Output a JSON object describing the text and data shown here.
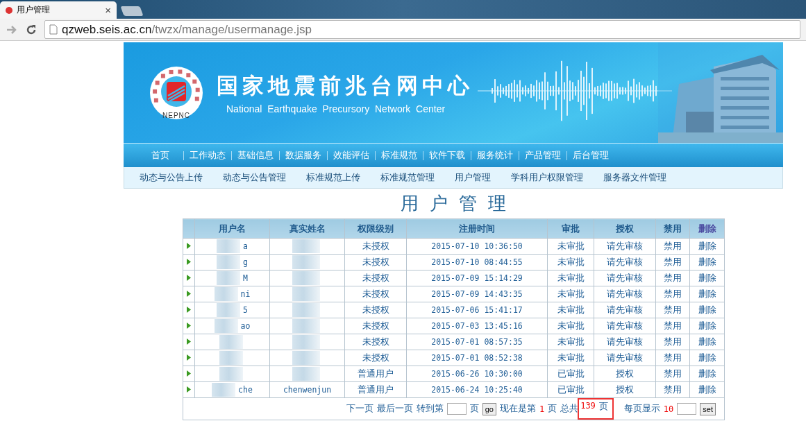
{
  "browser": {
    "tab": {
      "title": "用户管理",
      "close": "×"
    },
    "address": {
      "host": "qzweb.seis.ac.cn",
      "path": "/twzx/manage/usermanage.jsp"
    }
  },
  "banner": {
    "title": "国家地震前兆台网中心",
    "subtitle": "National  Earthquake  Precursory  Network  Center",
    "logo": {
      "letters": "NEPNC"
    }
  },
  "nav": {
    "items": [
      {
        "label": "首页"
      },
      {
        "label": "工作动态"
      },
      {
        "label": "基础信息"
      },
      {
        "label": "数据服务"
      },
      {
        "label": "效能评估"
      },
      {
        "label": "标准规范"
      },
      {
        "label": "软件下载"
      },
      {
        "label": "服务统计"
      },
      {
        "label": "产品管理"
      },
      {
        "label": "后台管理"
      }
    ]
  },
  "subnav": {
    "items": [
      {
        "label": "动态与公告上传"
      },
      {
        "label": "动态与公告管理"
      },
      {
        "label": "标准规范上传"
      },
      {
        "label": "标准规范管理"
      },
      {
        "label": "用户管理"
      },
      {
        "label": "学科用户权限管理"
      },
      {
        "label": "服务器文件管理"
      }
    ]
  },
  "page_title": "用 户 管 理",
  "table": {
    "redacted": true,
    "columns": [
      "用户名",
      "真实姓名",
      "权限级别",
      "注册时间",
      "审批",
      "授权",
      "禁用",
      "删除"
    ],
    "rows": [
      {
        "username": "a",
        "level": "未授权",
        "registered": "2015-07-10 10:36:50",
        "approval": "未审批",
        "authorize": "请先审核",
        "disable": "禁用",
        "delete": "删除"
      },
      {
        "username": "g",
        "level": "未授权",
        "registered": "2015-07-10 08:44:55",
        "approval": "未审批",
        "authorize": "请先审核",
        "disable": "禁用",
        "delete": "删除"
      },
      {
        "username": "M",
        "level": "未授权",
        "registered": "2015-07-09 15:14:29",
        "approval": "未审批",
        "authorize": "请先审核",
        "disable": "禁用",
        "delete": "删除"
      },
      {
        "username": "ni",
        "level": "未授权",
        "registered": "2015-07-09 14:43:35",
        "approval": "未审批",
        "authorize": "请先审核",
        "disable": "禁用",
        "delete": "删除"
      },
      {
        "username": "5",
        "level": "未授权",
        "registered": "2015-07-06 15:41:17",
        "approval": "未审批",
        "authorize": "请先审核",
        "disable": "禁用",
        "delete": "删除"
      },
      {
        "username": "ao",
        "level": "未授权",
        "registered": "2015-07-03 13:45:16",
        "approval": "未审批",
        "authorize": "请先审核",
        "disable": "禁用",
        "delete": "删除"
      },
      {
        "level": "未授权",
        "registered": "2015-07-01 08:57:35",
        "approval": "未审批",
        "authorize": "请先审核",
        "disable": "禁用",
        "delete": "删除"
      },
      {
        "level": "未授权",
        "registered": "2015-07-01 08:52:38",
        "approval": "未审批",
        "authorize": "请先审核",
        "disable": "禁用",
        "delete": "删除"
      },
      {
        "level": "普通用户",
        "registered": "2015-06-26 10:30:00",
        "approval": "已审批",
        "authorize": "授权",
        "disable": "禁用",
        "delete": "删除"
      },
      {
        "username": "che",
        "real_name": "chenwenjun",
        "level": "普通用户",
        "registered": "2015-06-24 10:25:40",
        "approval": "已审批",
        "authorize": "授权",
        "disable": "禁用",
        "delete": "删除"
      }
    ]
  },
  "pagination": {
    "next": "下一页",
    "last": "最后一页",
    "goto_label": "转到第",
    "goto_unit": "页",
    "go": "go",
    "current_label": "现在是第",
    "current": "1",
    "current_unit": "页",
    "total_label": "总共",
    "total": "139",
    "total_unit": "页",
    "total_highlighted": true,
    "per_page_label": "每页显示",
    "per_page": "10",
    "set": "set"
  }
}
